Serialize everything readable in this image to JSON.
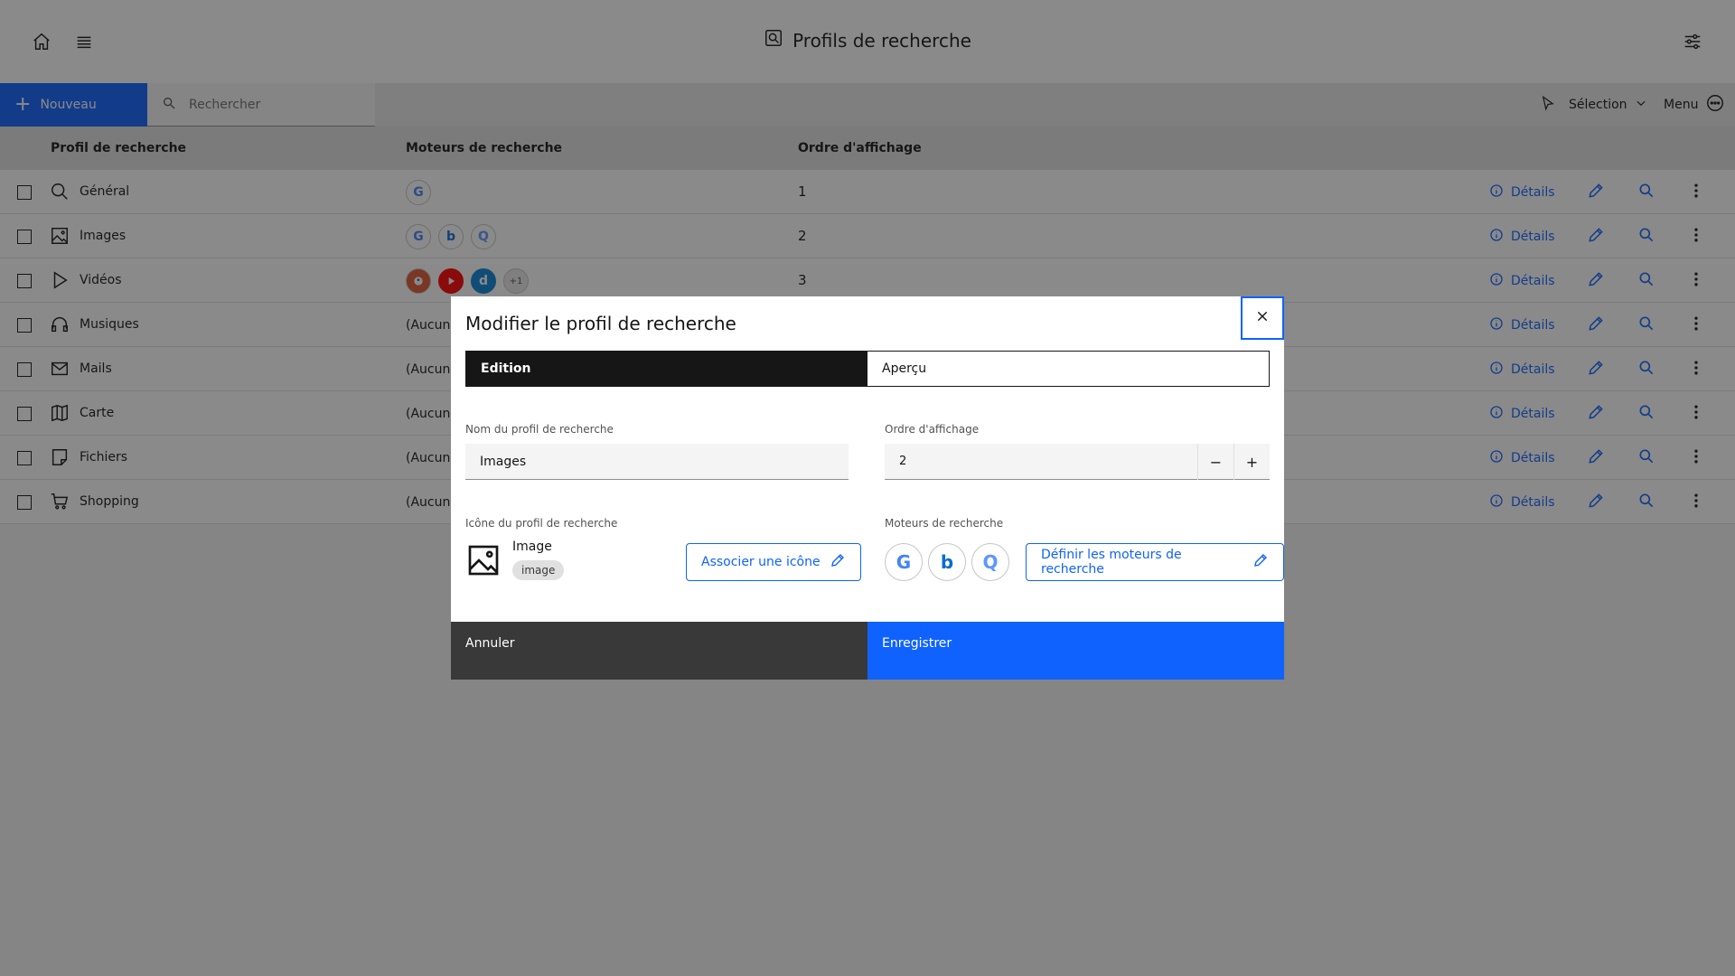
{
  "header": {
    "title": "Profils de recherche"
  },
  "toolbar": {
    "new_label": "Nouveau",
    "search_placeholder": "Rechercher",
    "selection_label": "Sélection",
    "menu_label": "Menu"
  },
  "table": {
    "columns": [
      "Profil de recherche",
      "Moteurs de recherche",
      "Ordre d'affichage"
    ],
    "details_label": "Détails",
    "rows": [
      {
        "name": "Général",
        "icon": "search-icon",
        "engines": [
          "G"
        ],
        "order": "1"
      },
      {
        "name": "Images",
        "icon": "image-icon",
        "engines": [
          "G",
          "b",
          "Q"
        ],
        "order": "2"
      },
      {
        "name": "Vidéos",
        "icon": "play-icon",
        "engines": [
          "duckduckgo",
          "youtube",
          "d"
        ],
        "more": "+1",
        "order": "3"
      },
      {
        "name": "Musiques",
        "icon": "headphones-icon",
        "engines_text": "(Aucun)",
        "order": ""
      },
      {
        "name": "Mails",
        "icon": "mail-icon",
        "engines_text": "(Aucun)",
        "order": ""
      },
      {
        "name": "Carte",
        "icon": "map-icon",
        "engines_text": "(Aucun)",
        "order": ""
      },
      {
        "name": "Fichiers",
        "icon": "file-icon",
        "engines_text": "(Aucun)",
        "order": ""
      },
      {
        "name": "Shopping",
        "icon": "cart-icon",
        "engines_text": "(Aucun)",
        "order": ""
      }
    ]
  },
  "modal": {
    "title": "Modifier le profil de recherche",
    "tabs": [
      "Edition",
      "Aperçu"
    ],
    "name_label": "Nom du profil de recherche",
    "name_value": "Images",
    "order_label": "Ordre d'affichage",
    "order_value": "2",
    "stepper_minus": "−",
    "stepper_plus": "+",
    "icon_label": "Icône du profil de recherche",
    "icon_name": "Image",
    "icon_tag": "image",
    "assign_icon_label": "Associer une icône",
    "engines_label": "Moteurs de recherche",
    "define_engines_label": "Définir les moteurs de recherche",
    "cancel_label": "Annuler",
    "save_label": "Enregistrer"
  },
  "colors": {
    "accent": "#0f62fe",
    "overlay": "rgba(22,22,22,0.5)",
    "google_blue": "#4285f4",
    "bing_blue": "#0c6ad6",
    "youtube_red": "#ff0000"
  }
}
